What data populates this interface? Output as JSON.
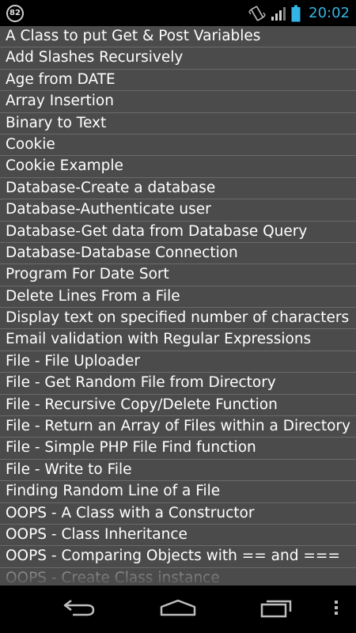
{
  "status_bar": {
    "notification_count": "82",
    "icons": [
      "notification-badge-icon",
      "vibrate-icon",
      "signal-icon",
      "battery-icon"
    ],
    "time": "20:02",
    "time_color": "#33b5e5"
  },
  "list": {
    "items": [
      "A Class to put Get & Post Variables",
      "Add Slashes Recursively",
      "Age from DATE",
      "Array Insertion",
      "Binary to Text",
      "Cookie",
      "Cookie Example",
      "Database-Create a database",
      "Database-Authenticate user",
      "Database-Get data from Database Query",
      "Database-Database Connection",
      "Program For Date Sort",
      "Delete Lines From a File",
      "Display text on specified number of characters",
      "Email validation with Regular Expressions",
      "File - File Uploader",
      "File - Get Random File from Directory",
      "File - Recursive Copy/Delete Function",
      "File - Return an Array of Files within a Directory",
      "File - Simple PHP File Find function",
      "File - Write to File",
      "Finding Random Line of a File",
      "OOPS - A Class with a Constructor",
      "OOPS - Class Inheritance",
      "OOPS - Comparing Objects with == and ===",
      "OOPS - Create Class instance"
    ],
    "background_color": "#4b4b4b",
    "divider_color": "#6a6a6a"
  },
  "nav_bar": {
    "icons": [
      "back-icon",
      "home-icon",
      "recent-apps-icon",
      "overflow-menu-icon"
    ]
  }
}
